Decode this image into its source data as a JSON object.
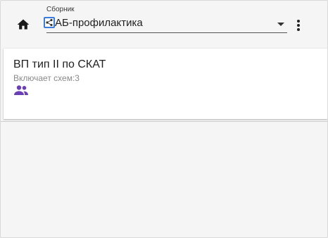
{
  "header": {
    "field_label": "Сборник",
    "selected_collection": "АБ-профилактика"
  },
  "icons": {
    "home": "home-icon",
    "share": "share-icon",
    "dropdown": "dropdown-arrow-icon",
    "menu": "more-vertical-icon",
    "group": "group-icon"
  },
  "card": {
    "title": "ВП тип II по СКАТ",
    "subtitle": "Включает схем:3"
  },
  "colors": {
    "accent_blue": "#3b7ddd",
    "group_icon": "#6a3fb5"
  }
}
